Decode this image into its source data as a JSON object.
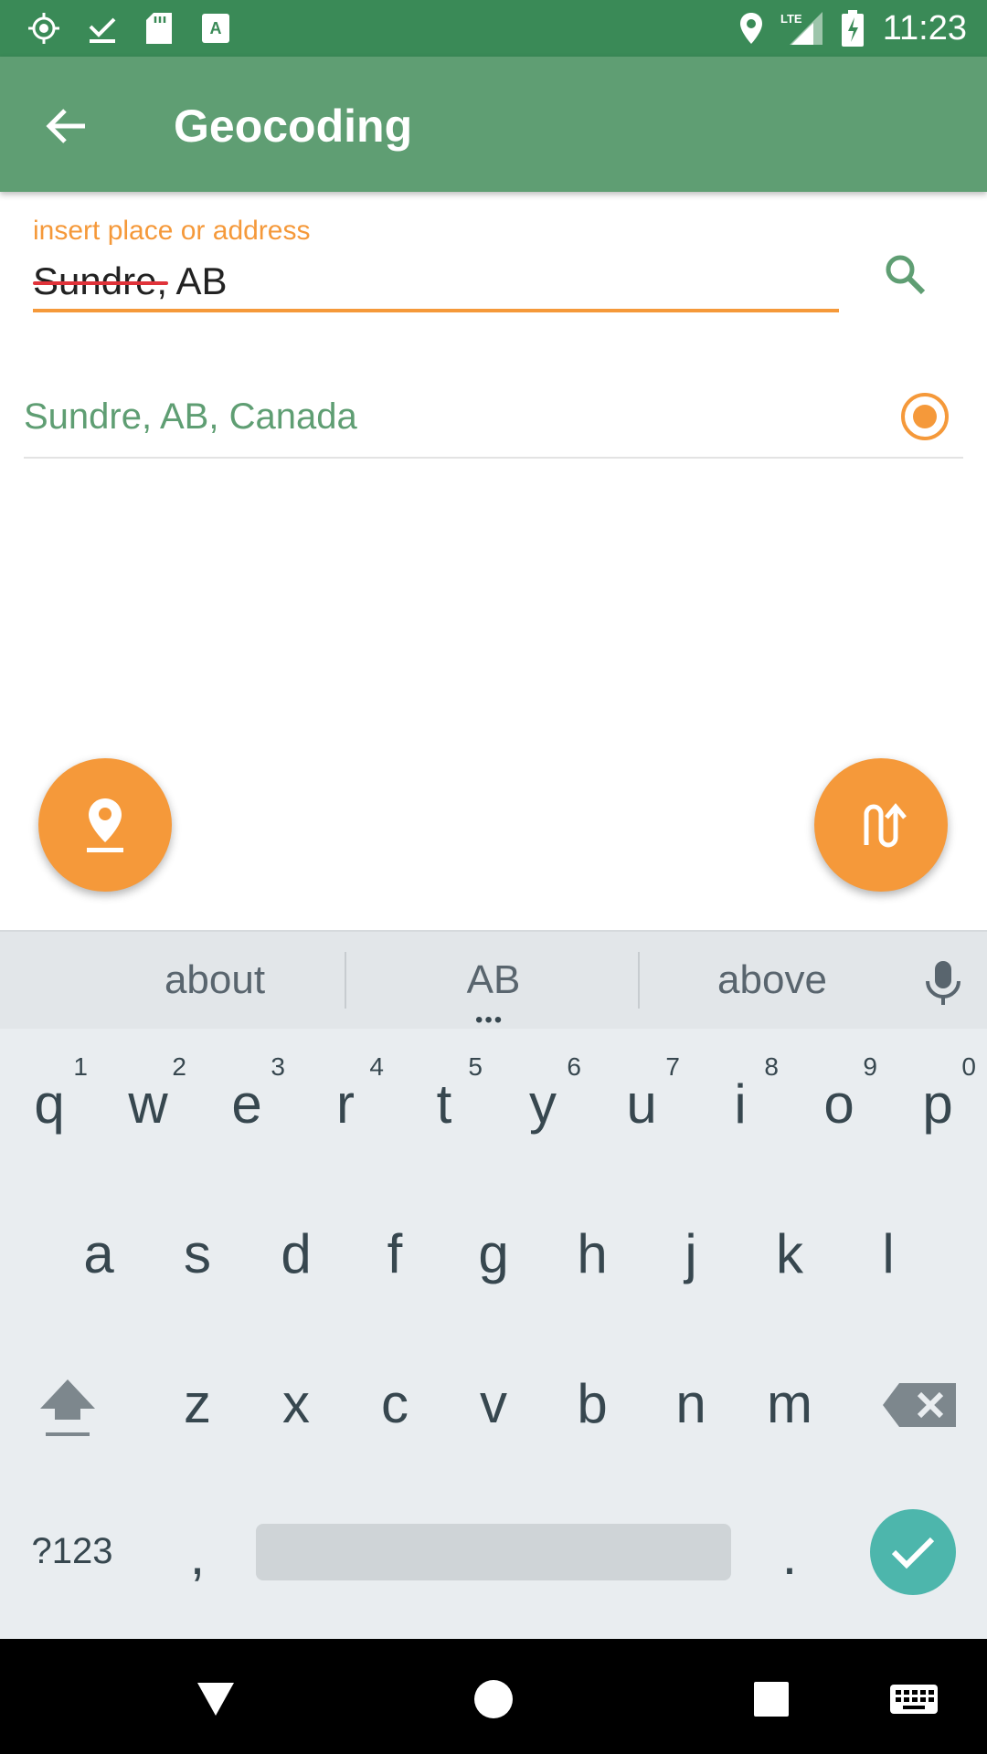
{
  "status_bar": {
    "time": "11:23",
    "network": "LTE",
    "icons": [
      "gps-icon",
      "download-done-icon",
      "sd-card-icon",
      "app-a-icon",
      "location-icon",
      "signal-icon",
      "battery-charging-icon"
    ]
  },
  "app_bar": {
    "title": "Geocoding"
  },
  "search": {
    "label": "insert place or address",
    "value": "Sundre, AB"
  },
  "results": [
    {
      "label": "Sundre, AB, Canada",
      "selected": true
    }
  ],
  "keyboard": {
    "suggestions": [
      "about",
      "AB",
      "above"
    ],
    "row1": [
      "q",
      "w",
      "e",
      "r",
      "t",
      "y",
      "u",
      "i",
      "o",
      "p"
    ],
    "row1_hints": [
      "1",
      "2",
      "3",
      "4",
      "5",
      "6",
      "7",
      "8",
      "9",
      "0"
    ],
    "row2": [
      "a",
      "s",
      "d",
      "f",
      "g",
      "h",
      "j",
      "k",
      "l"
    ],
    "row3": [
      "z",
      "x",
      "c",
      "v",
      "b",
      "n",
      "m"
    ],
    "symbols_key": "?123",
    "comma": ",",
    "period": "."
  },
  "colors": {
    "status_bar": "#3a8a57",
    "app_bar": "#5f9e73",
    "accent": "#f5993a",
    "result_text": "#5f9e73",
    "enter_key": "#4db6ac"
  }
}
